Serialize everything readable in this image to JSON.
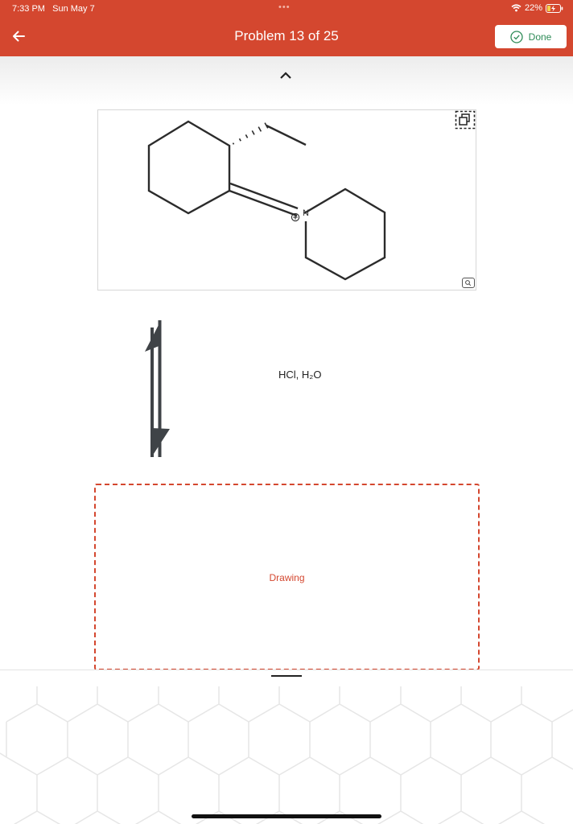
{
  "status_bar": {
    "time": "7:33 PM",
    "date": "Sun May 7",
    "battery": "22%",
    "icons": [
      "wifi-icon",
      "battery-charging-icon"
    ]
  },
  "header": {
    "title": "Problem 13 of 25",
    "done_label": "Done",
    "back_icon": "arrow-left-icon",
    "done_icon": "check-circle-icon",
    "background_color": "#d4472f"
  },
  "reactant": {
    "atom_label": "N",
    "charge": "⊕"
  },
  "reaction": {
    "reagents": "HCl, H₂O",
    "arrow": "equilibrium"
  },
  "product_area": {
    "placeholder": "Drawing",
    "accent_color": "#d4472f"
  }
}
